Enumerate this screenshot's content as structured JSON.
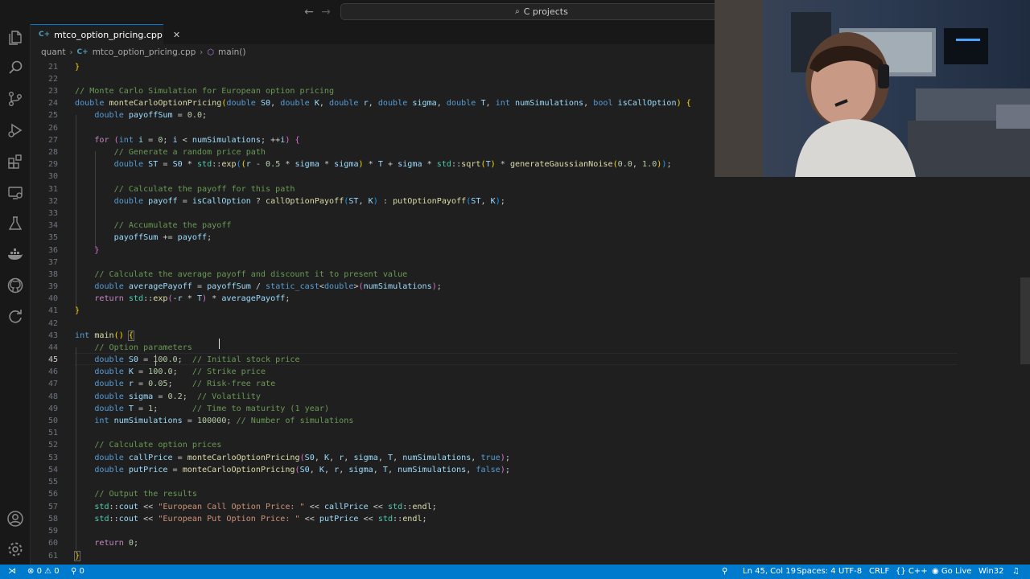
{
  "search": {
    "text": "C projects"
  },
  "tab": {
    "label": "mtco_option_pricing.cpp",
    "lang_badge": "C+"
  },
  "breadcrumb": {
    "folder": "quant",
    "file": "mtco_option_pricing.cpp",
    "symbol": "main()"
  },
  "editor": {
    "line_numbers": [
      "21",
      "22",
      "23",
      "24",
      "25",
      "26",
      "27",
      "28",
      "29",
      "30",
      "31",
      "32",
      "33",
      "34",
      "35",
      "36",
      "37",
      "38",
      "39",
      "40",
      "41",
      "42",
      "43",
      "44",
      "45",
      "46",
      "47",
      "48",
      "49",
      "50",
      "51",
      "52",
      "53",
      "54",
      "55",
      "56",
      "57",
      "58",
      "59",
      "60",
      "61"
    ],
    "current_line": "45"
  },
  "statusbar": {
    "errors": "0",
    "warnings": "0",
    "ports": "0",
    "position": "Ln 45, Col 19",
    "spaces": "Spaces: 4",
    "encoding": "UTF-8",
    "eol": "CRLF",
    "language": "C++",
    "golive": "Go Live",
    "platform": "Win32"
  },
  "colors": {
    "accent": "#007acc",
    "editor_bg": "#1f1f1f",
    "keyword": "#569cd6",
    "function": "#dcdcaa",
    "comment": "#6a9955",
    "string": "#ce9178",
    "number": "#b5cea8"
  },
  "icons": [
    "explorer-icon",
    "search-icon",
    "source-control-icon",
    "run-debug-icon",
    "extensions-icon",
    "remote-explorer-icon",
    "testing-icon",
    "docker-icon",
    "github-icon",
    "refresh-icon",
    "account-icon",
    "settings-gear-icon"
  ]
}
